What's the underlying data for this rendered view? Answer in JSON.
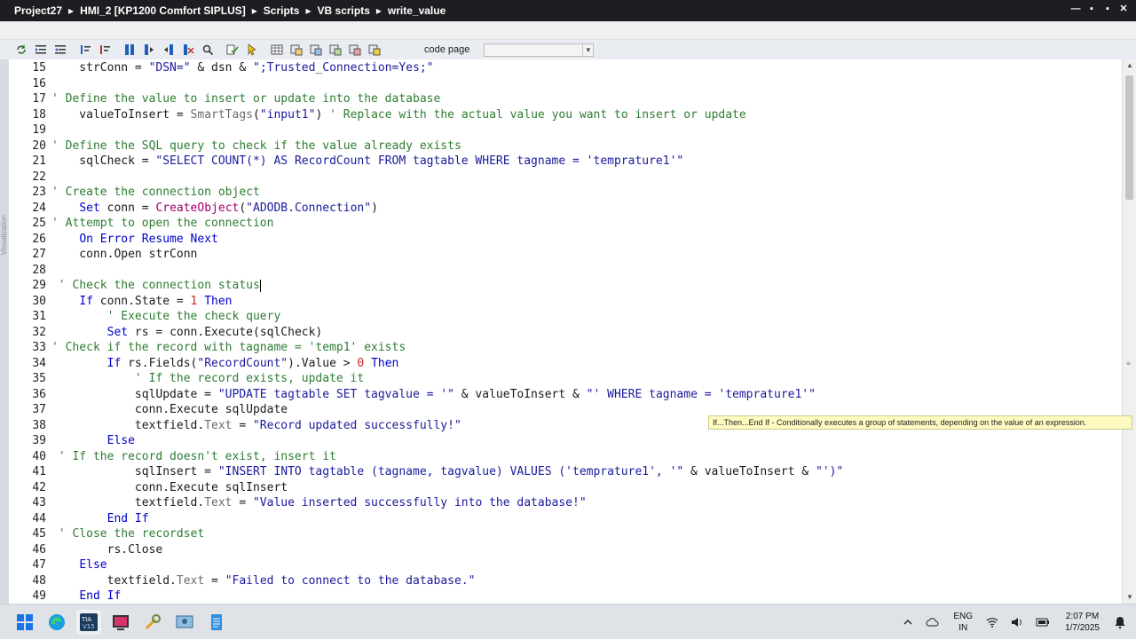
{
  "window": {
    "breadcrumbs": [
      "Project27",
      "HMI_2 [KP1200 Comfort SIPLUS]",
      "Scripts",
      "VB scripts",
      "write_value"
    ],
    "separator": "▸",
    "controls": [
      "—",
      "▪",
      "▪",
      "✕"
    ]
  },
  "toolbar": {
    "code_page_label": "code page",
    "code_page_value": ""
  },
  "left_strip": {
    "label": "Visualization"
  },
  "editor": {
    "lines": [
      {
        "n": "15",
        "html": "    strConn = <span class=\"st\">\"DSN=\"</span> &amp; dsn &amp; <span class=\"st\">\";Trusted_Connection=Yes;\"</span>"
      },
      {
        "n": "16",
        "html": ""
      },
      {
        "n": "17",
        "html": "<span class=\"cm\">' Define the value to insert or update into the database</span>"
      },
      {
        "n": "18",
        "html": "    valueToInsert = <span class=\"pr\">SmartTags</span>(<span class=\"st\">\"input1\"</span>) <span class=\"cm\">' Replace with the actual value you want to insert or update</span>"
      },
      {
        "n": "19",
        "html": ""
      },
      {
        "n": "20",
        "html": "<span class=\"cm\">' Define the SQL query to check if the value already exists</span>"
      },
      {
        "n": "21",
        "html": "    sqlCheck = <span class=\"st\">\"SELECT COUNT(*) AS RecordCount FROM tagtable WHERE tagname = 'temprature1'\"</span>"
      },
      {
        "n": "22",
        "html": ""
      },
      {
        "n": "23",
        "html": "<span class=\"cm\">' Create the connection object</span>"
      },
      {
        "n": "24",
        "html": "    <span class=\"kw\">Set</span> conn = <span class=\"fn\">CreateObject</span>(<span class=\"st\">\"ADODB.Connection\"</span>)"
      },
      {
        "n": "25",
        "html": "<span class=\"cm\">' Attempt to open the connection</span>"
      },
      {
        "n": "26",
        "html": "    <span class=\"kw\">On Error Resume Next</span>"
      },
      {
        "n": "27",
        "html": "    conn.Open strConn"
      },
      {
        "n": "28",
        "html": ""
      },
      {
        "n": "29",
        "html": " <span class=\"cm\">' Check the connection status</span><span class=\"caret\"></span>"
      },
      {
        "n": "30",
        "html": "    <span class=\"kw\">If</span> conn.State = <span class=\"nm\">1</span> <span class=\"kw\">Then</span>"
      },
      {
        "n": "31",
        "html": "        <span class=\"cm\">' Execute the check query</span>"
      },
      {
        "n": "32",
        "html": "        <span class=\"kw\">Set</span> rs = conn.Execute(sqlCheck)"
      },
      {
        "n": "33",
        "html": "<span class=\"cm\">' Check if the record with tagname = 'temp1' exists</span>"
      },
      {
        "n": "34",
        "html": "        <span class=\"kw\">If</span> rs.Fields(<span class=\"st\">\"RecordCount\"</span>).Value &gt; <span class=\"nm\">0</span> <span class=\"kw\">Then</span>"
      },
      {
        "n": "35",
        "html": "            <span class=\"cm\">' If the record exists, update it</span>"
      },
      {
        "n": "36",
        "html": "            sqlUpdate = <span class=\"st\">\"UPDATE tagtable SET tagvalue = '\"</span> &amp; valueToInsert &amp; <span class=\"st\">\"' WHERE tagname = 'temprature1'\"</span>"
      },
      {
        "n": "37",
        "html": "            conn.Execute sqlUpdate"
      },
      {
        "n": "38",
        "html": "            textfield.<span class=\"pr\">Text</span> = <span class=\"st\">\"Record updated successfully!\"</span>"
      },
      {
        "n": "39",
        "html": "        <span class=\"kw\">Else</span>"
      },
      {
        "n": "40",
        "html": " <span class=\"cm\">' If the record doesn't exist, insert it</span>"
      },
      {
        "n": "41",
        "html": "            sqlInsert = <span class=\"st\">\"INSERT INTO tagtable (tagname, tagvalue) VALUES ('temprature1', '\"</span> &amp; valueToInsert &amp; <span class=\"st\">\"')\"</span>"
      },
      {
        "n": "42",
        "html": "            conn.Execute sqlInsert"
      },
      {
        "n": "43",
        "html": "            textfield.<span class=\"pr\">Text</span> = <span class=\"st\">\"Value inserted successfully into the database!\"</span>"
      },
      {
        "n": "44",
        "html": "        <span class=\"kw\">End If</span>"
      },
      {
        "n": "45",
        "html": " <span class=\"cm\">' Close the recordset</span>"
      },
      {
        "n": "46",
        "html": "        rs.Close"
      },
      {
        "n": "47",
        "html": "    <span class=\"kw\">Else</span>"
      },
      {
        "n": "48",
        "html": "        textfield.<span class=\"pr\">Text</span> = <span class=\"st\">\"Failed to connect to the database.\"</span>"
      },
      {
        "n": "49",
        "html": "    <span class=\"kw\">End If</span>"
      }
    ]
  },
  "tooltip": {
    "text": "If...Then...End If - Conditionally executes a group of statements, depending on the value of an expression."
  },
  "taskbar": {
    "lang_line1": "ENG",
    "lang_line2": "IN",
    "time": "2:07 PM",
    "date": "1/7/2025"
  }
}
